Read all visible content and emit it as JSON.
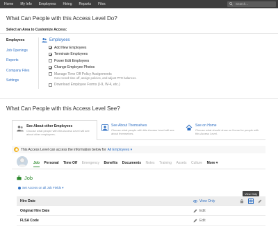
{
  "nav": {
    "items": [
      "Home",
      "My Info",
      "Employees",
      "Hiring",
      "Reports",
      "Files"
    ],
    "search_placeholder": "Search..."
  },
  "section1": {
    "title": "What Can People with this Access Level Do?",
    "subtitle": "Select an Area to Customize Access:"
  },
  "areas": [
    "Employees",
    "Job Openings",
    "Reports",
    "Company Files",
    "Settings"
  ],
  "permissions": {
    "group_label": "Employees",
    "items": [
      {
        "label": "Add New Employees",
        "checked": true,
        "disabled": false
      },
      {
        "label": "Terminate Employees",
        "checked": true,
        "disabled": false
      },
      {
        "label": "Power Edit Employees",
        "checked": false,
        "disabled": false
      },
      {
        "label": "Change Employee Photos",
        "checked": true,
        "disabled": false
      },
      {
        "label": "Manage Time Off Policy Assignments",
        "checked": false,
        "disabled": true
      },
      {
        "label": "Download Employee Forms (I-9, W-4, etc.)",
        "checked": false,
        "disabled": true
      }
    ],
    "timeoff_desc": "Can record time off, assign policies, and adjust PTO balances."
  },
  "section2": {
    "title": "What Can People with this Access Level See?"
  },
  "cards": [
    {
      "title": "See About other Employees",
      "desc": "Choose what people with this Access Level will see about other employees."
    },
    {
      "title": "See About Themselves",
      "desc": "Choose what people with this Access Level will see about themselves."
    },
    {
      "title": "See on Home",
      "desc": "Choose what should show on Home for people with this Access Level."
    }
  ],
  "infobar": {
    "text": "This Access Level can access the information below for",
    "dropdown": "All Employees ▾"
  },
  "tabs": [
    {
      "label": "Job",
      "state": "active"
    },
    {
      "label": "Personal",
      "state": "normal"
    },
    {
      "label": "Time Off",
      "state": "normal"
    },
    {
      "label": "Emergency",
      "state": "muted"
    },
    {
      "label": "Benefits",
      "state": "normal"
    },
    {
      "label": "Documents",
      "state": "normal"
    },
    {
      "label": "Notes",
      "state": "muted"
    },
    {
      "label": "Training",
      "state": "muted"
    },
    {
      "label": "Assets",
      "state": "muted"
    },
    {
      "label": "Culture",
      "state": "muted"
    },
    {
      "label": "More ▾",
      "state": "normal"
    }
  ],
  "job": {
    "title": "Job",
    "set_access": "Set Access on all Job Fields ▾",
    "tooltip": "View Only",
    "header_label": "Hire Date",
    "header_access": "View Only",
    "rows": [
      {
        "label": "Original Hire Date",
        "access": "Edit"
      },
      {
        "label": "FLSA Code",
        "access": "Edit"
      }
    ]
  },
  "colors": {
    "link": "#2e6fc3",
    "accent_green": "#2e8a2e",
    "nav_bg": "#3d3d3d",
    "lock_badge": "#f2b21b"
  }
}
